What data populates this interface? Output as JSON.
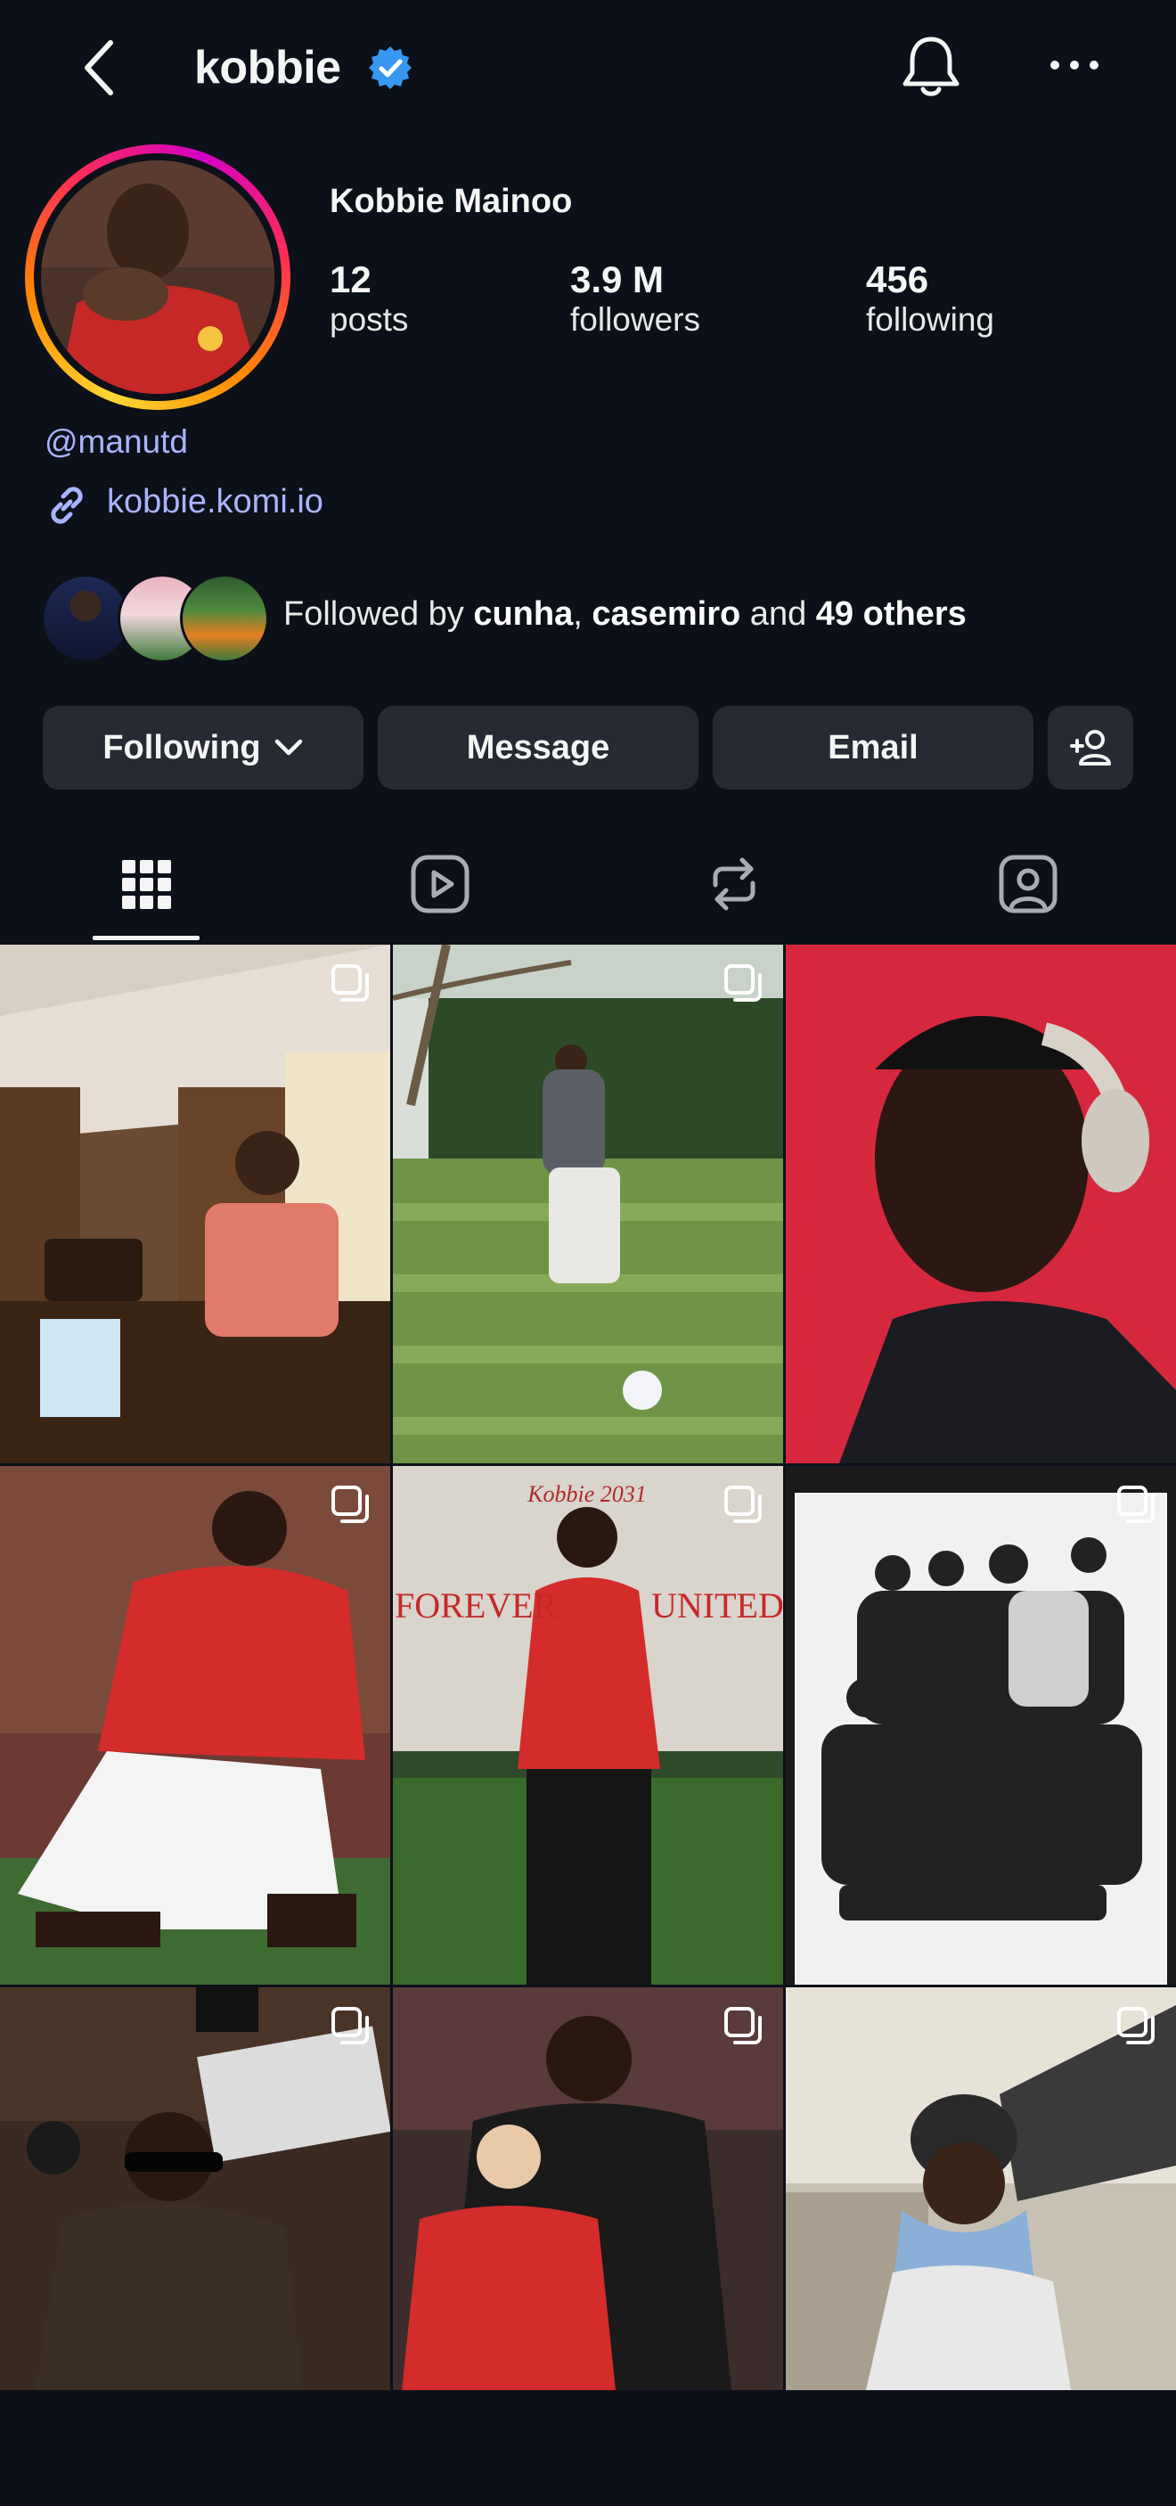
{
  "header": {
    "handle": "kobbie"
  },
  "profile": {
    "full_name": "Kobbie Mainoo",
    "stats": [
      {
        "value": "12",
        "label": "posts"
      },
      {
        "value": "3.9 M",
        "label": "followers"
      },
      {
        "value": "456",
        "label": "following"
      }
    ],
    "mention": "@manutd",
    "link": "kobbie.komi.io"
  },
  "followed_by": {
    "prefix": "Followed by ",
    "user1": "cunha",
    "comma": ", ",
    "user2": "casemiro",
    "and": " and ",
    "others": "49 others"
  },
  "buttons": {
    "following": "Following",
    "message": "Message",
    "email": "Email"
  },
  "tabs": [
    "grid-tab",
    "reels-tab",
    "reposts-tab",
    "tagged-tab"
  ],
  "posts": {
    "post5": {
      "top_text": "Kobbie 2031",
      "left_text": "FOREVER",
      "right_text": "UNITED"
    }
  },
  "icons": [
    "back-arrow-icon",
    "verified-badge-icon",
    "bell-icon",
    "more-dots-icon",
    "link-icon",
    "chevron-down-icon",
    "add-person-icon",
    "grid-icon",
    "reels-icon",
    "repost-icon",
    "tagged-icon",
    "multi-photo-icon"
  ],
  "colors": {
    "background": "#0c1018",
    "button": "#262b33",
    "link": "#a9b4ff",
    "verified": "#3897f0"
  }
}
